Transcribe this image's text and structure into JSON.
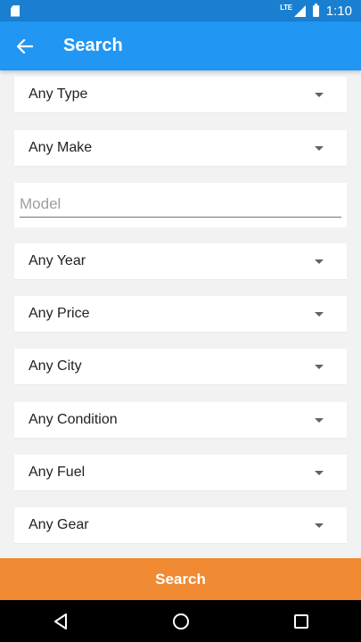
{
  "statusbar": {
    "network": "LTE",
    "time": "1:10"
  },
  "appbar": {
    "title": "Search"
  },
  "fields": {
    "type": "Any Type",
    "make": "Any Make",
    "year": "Any Year",
    "price": "Any Price",
    "city": "Any City",
    "condition": "Any Condition",
    "fuel": "Any Fuel",
    "gear": "Any Gear"
  },
  "model": {
    "placeholder": "Model",
    "value": ""
  },
  "search_button": "Search",
  "colors": {
    "appbar": "#2196f3",
    "statusbar": "#1a7fd0",
    "accent": "#f08a33",
    "background": "#f2f2f2"
  }
}
